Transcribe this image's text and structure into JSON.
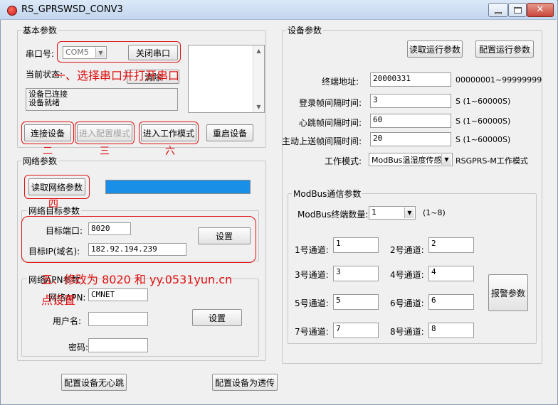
{
  "window": {
    "title": "RS_GPRSWSD_CONV3"
  },
  "basic": {
    "group_label": "基本参数",
    "port_label": "串口号:",
    "port_value": "COM5",
    "close_port_button": "关闭串口",
    "status_label": "当前状态:",
    "clear_button": "清除",
    "status_lines": [
      "设备已连接",
      "设备就绪"
    ],
    "connect_button": "连接设备",
    "config_mode_button": "进入配置模式",
    "work_mode_button": "进入工作模式",
    "restart_button": "重启设备"
  },
  "network": {
    "group_label": "网络参数",
    "read_button": "读取网络参数",
    "target_group_label": "网络目标参数",
    "target_port_label": "目标端口:",
    "target_port_value": "8020",
    "target_ip_label": "目标IP(域名):",
    "target_ip_value": "182.92.194.239",
    "set_button": "设置",
    "apn_group_label": "网络APN参数",
    "apn_label": "网络APN:",
    "apn_value": "CMNET",
    "username_label": "用户名:",
    "username_value": "",
    "password_label": "密码:",
    "password_value": "",
    "apn_set_button": "设置"
  },
  "device": {
    "group_label": "设备参数",
    "read_run_button": "读取运行参数",
    "config_run_button": "配置运行参数",
    "terminal_addr_label": "终端地址:",
    "terminal_addr_value": "20000331",
    "terminal_addr_hint": "00000001~99999999",
    "login_label": "登录帧间隔时间:",
    "login_value": "3",
    "login_hint": "S (1~60000S)",
    "heartbeat_label": "心跳帧间隔时间:",
    "heartbeat_value": "60",
    "heartbeat_hint": "S (1~60000S)",
    "upload_label": "主动上送帧间隔时间:",
    "upload_value": "20",
    "upload_hint": "S (1~60000S)",
    "work_mode_label": "工作模式:",
    "work_mode_value": "ModBus温湿度传感",
    "work_mode_hint": "RSGPRS-M工作模式"
  },
  "modbus": {
    "group_label": "ModBus通信参数",
    "count_label": "ModBus终端数量:",
    "count_value": "1",
    "count_hint": "(1~8)",
    "channels": [
      {
        "label": "1号通道:",
        "value": "1"
      },
      {
        "label": "2号通道:",
        "value": "2"
      },
      {
        "label": "3号通道:",
        "value": "3"
      },
      {
        "label": "4号通道:",
        "value": "4"
      },
      {
        "label": "5号通道:",
        "value": "5"
      },
      {
        "label": "6号通道:",
        "value": "6"
      },
      {
        "label": "7号通道:",
        "value": "7"
      },
      {
        "label": "8号通道:",
        "value": "8"
      }
    ],
    "alarm_button": "报警参数"
  },
  "bottom": {
    "no_heartbeat_button": "配置设备无心跳",
    "transparent_button": "配置设备为透传"
  },
  "annotations": {
    "step_one": "一、选择串口并打开串口",
    "step_two": "二",
    "step_three": "三",
    "step_four": "四",
    "step_five_a": "五、修改为 8020 和 yy.0531yun.cn",
    "step_five_b": "点设置",
    "step_six": "六"
  },
  "colors": {
    "annotation_red": "#e01010",
    "progress_blue": "#1a8fe8"
  }
}
